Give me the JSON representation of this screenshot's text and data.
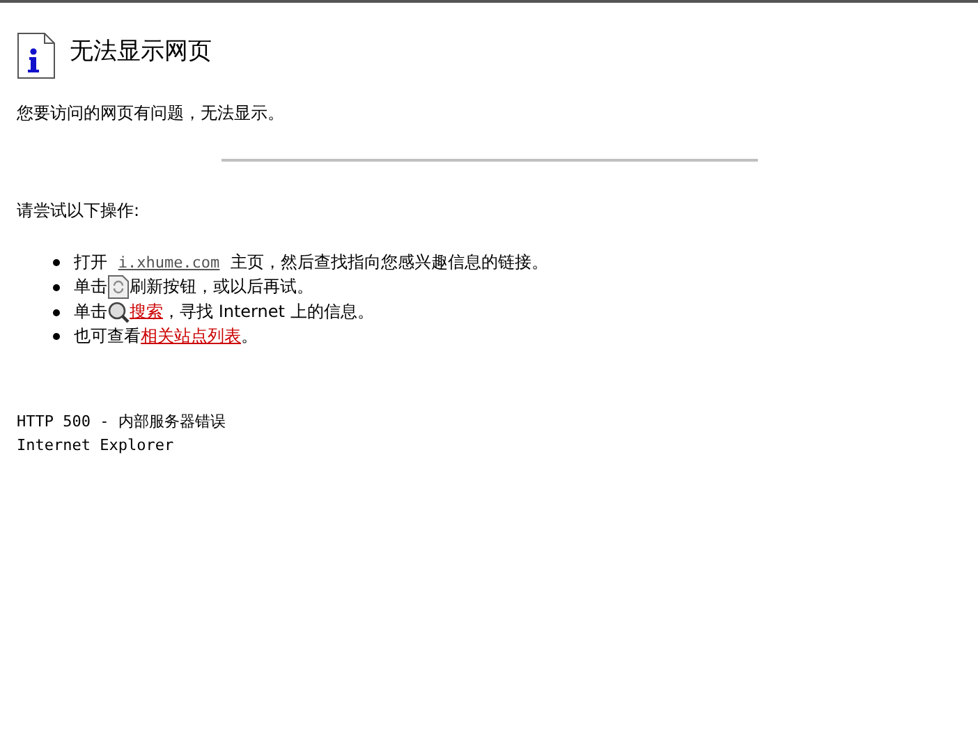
{
  "title": "无法显示网页",
  "message": "您要访问的网页有问题，无法显示。",
  "prompt": "请尝试以下操作:",
  "suggestions": [
    {
      "parts": [
        {
          "kind": "text",
          "text": "打开 "
        },
        {
          "kind": "url",
          "text": "i.xhume.com"
        },
        {
          "kind": "text",
          "text": " 主页，然后查找指向您感兴趣信息的链接。"
        }
      ]
    },
    {
      "parts": [
        {
          "kind": "text",
          "text": "单击"
        },
        {
          "kind": "refresh_icon"
        },
        {
          "kind": "text",
          "text": "刷新按钮，或以后再试。"
        }
      ]
    },
    {
      "parts": [
        {
          "kind": "text",
          "text": "单击"
        },
        {
          "kind": "search_icon"
        },
        {
          "kind": "link",
          "text": "搜索"
        },
        {
          "kind": "text",
          "text": "，寻找 Internet 上的信息。"
        }
      ]
    },
    {
      "parts": [
        {
          "kind": "text",
          "text": "也可查看"
        },
        {
          "kind": "link",
          "text": "相关站点列表"
        },
        {
          "kind": "text",
          "text": "。"
        }
      ]
    }
  ],
  "error_code": "HTTP 500 - 内部服务器错误",
  "browser": "Internet Explorer"
}
